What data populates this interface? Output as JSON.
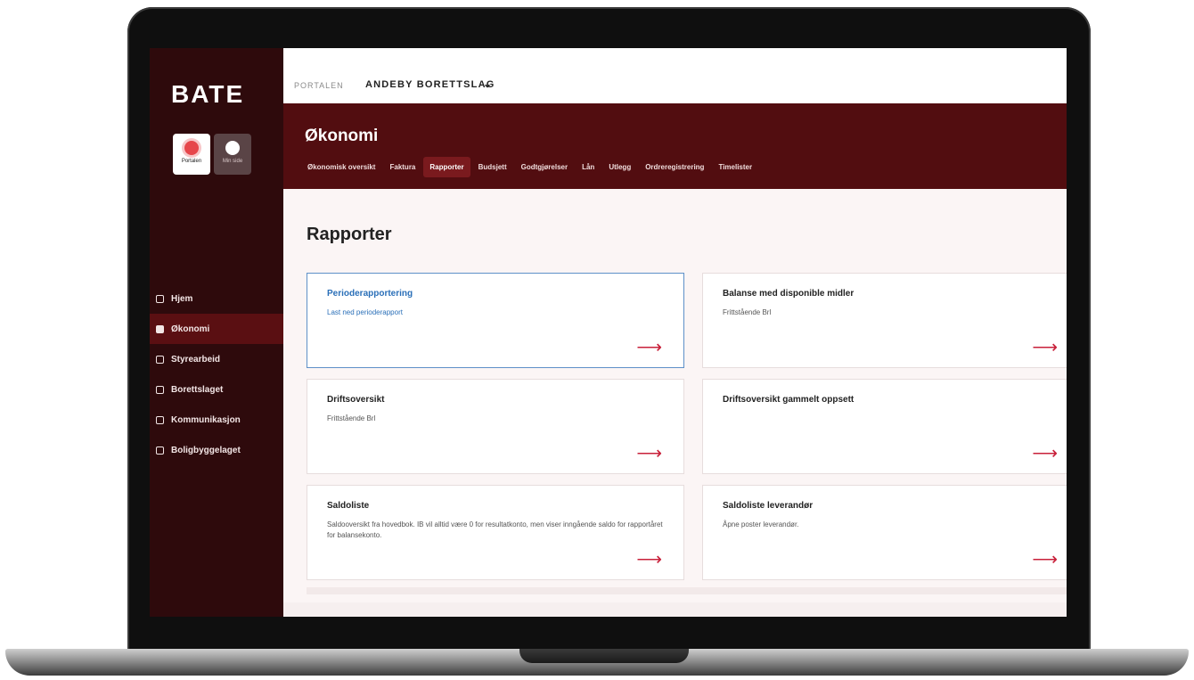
{
  "app": {
    "logo": "BATE"
  },
  "modes": [
    {
      "label": "Portalen",
      "icon": "portal-icon",
      "selected": true
    },
    {
      "label": "Min side",
      "icon": "user-icon",
      "selected": false
    }
  ],
  "breadcrumb": {
    "portal": "PORTALEN",
    "organization": "ANDEBY BORETTSLAG",
    "chevron": "⌄"
  },
  "sidebar": {
    "items": [
      {
        "label": "Hjem",
        "icon": "grid-icon",
        "active": false
      },
      {
        "label": "Økonomi",
        "icon": "chart-icon",
        "active": true
      },
      {
        "label": "Styrearbeid",
        "icon": "briefcase-icon",
        "active": false
      },
      {
        "label": "Borettslaget",
        "icon": "house-icon",
        "active": false
      },
      {
        "label": "Kommunikasjon",
        "icon": "chat-icon",
        "active": false
      },
      {
        "label": "Boligbyggelaget",
        "icon": "building-icon",
        "active": false
      }
    ]
  },
  "section": {
    "title": "Økonomi",
    "tabs": [
      {
        "label": "Økonomisk oversikt",
        "active": false
      },
      {
        "label": "Faktura",
        "active": false
      },
      {
        "label": "Rapporter",
        "active": true
      },
      {
        "label": "Budsjett",
        "active": false
      },
      {
        "label": "Godtgjørelser",
        "active": false
      },
      {
        "label": "Lån",
        "active": false
      },
      {
        "label": "Utlegg",
        "active": false
      },
      {
        "label": "Ordreregistrering",
        "active": false
      },
      {
        "label": "Timelister",
        "active": false
      }
    ]
  },
  "page": {
    "title": "Rapporter",
    "cards": [
      {
        "title": "Perioderapportering",
        "subtitle": "Last ned perioderapport",
        "selected": true,
        "arrow": "⟶"
      },
      {
        "title": "Balanse med disponible midler",
        "subtitle": "Frittstående Brl",
        "selected": false,
        "arrow": "⟶"
      },
      {
        "title": "Driftsoversikt",
        "subtitle": "Frittstående Brl",
        "selected": false,
        "arrow": "⟶"
      },
      {
        "title": "Driftsoversikt gammelt oppsett",
        "subtitle": "",
        "selected": false,
        "arrow": "⟶"
      },
      {
        "title": "Saldoliste",
        "subtitle": "Saldooversikt fra hovedbok. IB vil alltid være 0 for resultatkonto, men viser inngående saldo for rapportåret for balansekonto.",
        "selected": false,
        "arrow": "⟶"
      },
      {
        "title": "Saldoliste leverandør",
        "subtitle": "Åpne poster leverandør.",
        "selected": false,
        "arrow": "⟶"
      }
    ]
  },
  "colors": {
    "sidebar": "#2e0a0c",
    "band": "#520d10",
    "accent": "#c8203a",
    "link": "#2a6fb8"
  }
}
